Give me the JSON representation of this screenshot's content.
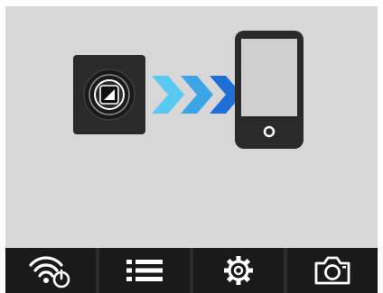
{
  "colors": {
    "background": "#d7d7d7",
    "camera_body": "#2a2a2a",
    "phone_screen": "#d0d0d0",
    "arrow_light": "#4fc1ef",
    "arrow_dark": "#1e73d8",
    "toolbar_bg": "#1a1a1a",
    "icon_color": "#ffffff"
  },
  "illustration": {
    "camera_icon": "action-camera-icon",
    "transfer_icon": "transfer-arrows-icon",
    "phone_icon": "smartphone-icon"
  },
  "toolbar": {
    "buttons": [
      {
        "icon": "wifi-power-icon"
      },
      {
        "icon": "list-icon"
      },
      {
        "icon": "settings-gear-icon"
      },
      {
        "icon": "camera-icon"
      }
    ]
  }
}
